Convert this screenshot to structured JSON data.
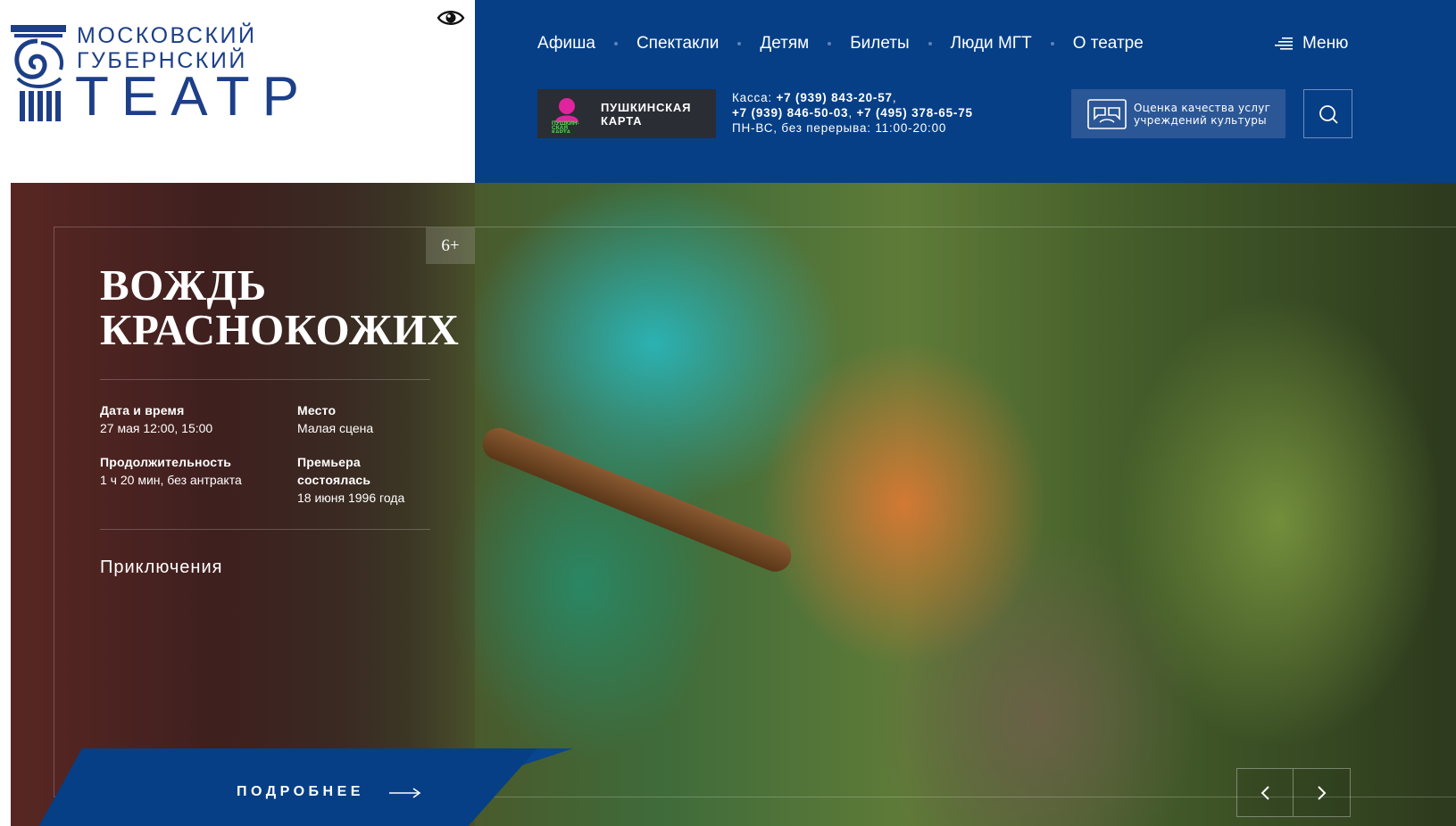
{
  "logo": {
    "line1": "МОСКОВСКИЙ",
    "line2": "ГУБЕРНСКИЙ",
    "line3": "ТЕАТР"
  },
  "accessibility": {
    "icon": "eye-icon"
  },
  "nav": {
    "items": [
      {
        "label": "Афиша"
      },
      {
        "label": "Спектакли"
      },
      {
        "label": "Детям"
      },
      {
        "label": "Билеты"
      },
      {
        "label": "Люди МГТ"
      },
      {
        "label": "О театре"
      }
    ],
    "menu_label": "Меню"
  },
  "pushkin_card": {
    "line1": "ПУШКИНСКАЯ",
    "line2": "КАРТА",
    "logo_text": "ПУШКИН-СКАЯ КАРТА"
  },
  "contacts": {
    "kassa_label": "Касса: ",
    "phone1": "+7 (939) 843-20-57",
    "sep1": ",",
    "phone2": "+7 (939) 846-50-03",
    "sep2": ", ",
    "phone3": "+7 (495) 378-65-75",
    "hours": "ПН-ВС, без перерыва: 11:00-20:00"
  },
  "quality": {
    "line1": "Оценка качества услуг",
    "line2": "учреждений культуры"
  },
  "hero": {
    "age": "6+",
    "title_line1": "ВОЖДЬ",
    "title_line2": "КРАСНОКОЖИХ",
    "datetime_label": "Дата и время",
    "datetime_value": "27 мая 12:00, 15:00",
    "place_label": "Место",
    "place_value": "Малая сцена",
    "duration_label": "Продолжительность",
    "duration_value": "1 ч 20 мин, без антракта",
    "premiere_label_1": "Премьера",
    "premiere_label_2": "состоялась",
    "premiere_value": "18 июня 1996 года",
    "genre": "Приключения",
    "more_label": "ПОДРОБНЕЕ"
  },
  "colors": {
    "brand_blue": "#063f86",
    "logo_blue": "#1d3f87",
    "pushkin_bg": "#2a2d34",
    "pushkin_accent": "#e0249e",
    "pushkin_green": "#4ee04a"
  }
}
